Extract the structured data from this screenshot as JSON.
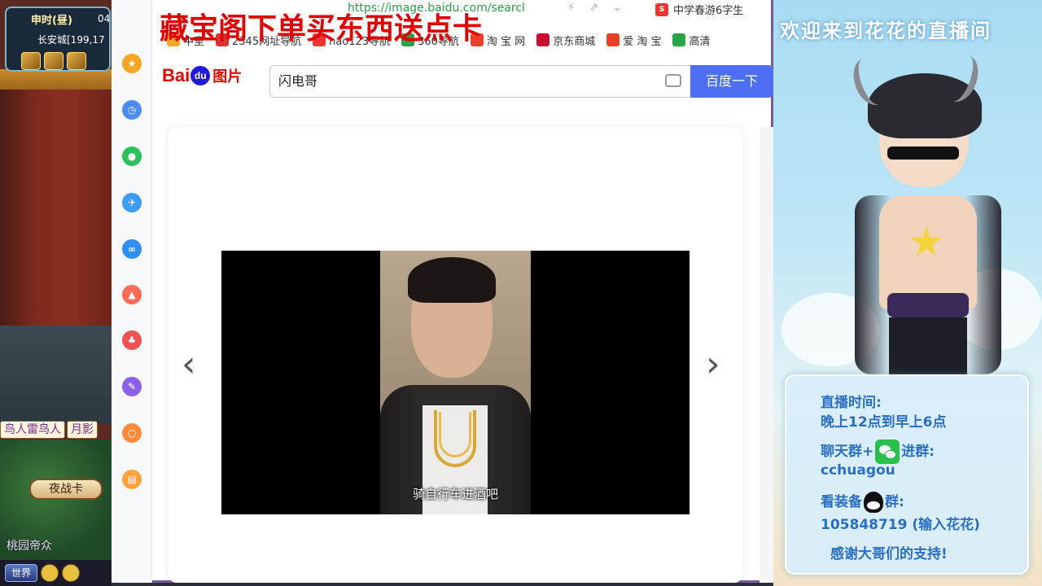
{
  "game": {
    "time_label": "申时(昼)",
    "time_num": "04",
    "location": "长安城[199,17",
    "npc_tab1": "鸟人雷鸟人",
    "npc_tab2": "月影",
    "yezhan_label": "夜战卡",
    "scene_label": "桃园帝众",
    "world_button": "世界"
  },
  "promo_text": "藏宝阁下单买东西送点卡",
  "browser": {
    "address": "https://image.baidu.com/searcl",
    "right_tab": "中学春游6字生",
    "bookmarks": [
      {
        "label": "中室",
        "icon": "star-icon",
        "color": "#f5a623"
      },
      {
        "label": "2345网址导航",
        "icon": "2345-icon",
        "color": "#d33"
      },
      {
        "label": "hao123导航",
        "icon": "hao123-icon",
        "color": "#e33"
      },
      {
        "label": "360导航",
        "icon": "360-icon",
        "color": "#2fa24a"
      },
      {
        "label": "淘 宝 网",
        "icon": "taobao-icon",
        "color": "#e8402a"
      },
      {
        "label": "京东商城",
        "icon": "jd-icon",
        "color": "#c8102e"
      },
      {
        "label": "爱 淘 宝",
        "icon": "aitaobao-icon",
        "color": "#e8402a"
      },
      {
        "label": "高清",
        "icon": "plus-icon",
        "color": "#28a745"
      }
    ],
    "logo_bai": "Bai",
    "logo_du": "du",
    "logo_tu": "图片",
    "search_value": "闪电哥",
    "search_button": "百度一下",
    "subtitle": "骑自行车进酒吧",
    "prev_arrow": "‹",
    "next_arrow": "›"
  },
  "rail": [
    {
      "name": "favorites-icon",
      "color": "#f5a623"
    },
    {
      "name": "history-icon",
      "color": "#4a8cf0"
    },
    {
      "name": "wechat-icon",
      "color": "#2cc05a"
    },
    {
      "name": "translate-icon",
      "color": "#3a9cf5"
    },
    {
      "name": "weibo-icon",
      "color": "#2f8ff5"
    },
    {
      "name": "image-tool-icon",
      "color": "#ff6b57"
    },
    {
      "name": "pdf-icon",
      "color": "#f05050"
    },
    {
      "name": "edit-icon",
      "color": "#8a60e8"
    },
    {
      "name": "search-tool-icon",
      "color": "#ff8a3a"
    },
    {
      "name": "notes-icon",
      "color": "#ffa23a"
    }
  ],
  "stream": {
    "welcome": "欢迎来到花花的直播间",
    "time_title": "直播时间:",
    "time_value": "晚上12点到早上6点",
    "chat_prefix": "聊天群+",
    "chat_suffix": "进群:",
    "wechat_id": "cchuagou",
    "gear_prefix": "看装备",
    "gear_suffix": "群:",
    "qq_group": "105848719 (输入花花)",
    "thanks": "感谢大哥们的支持!"
  }
}
